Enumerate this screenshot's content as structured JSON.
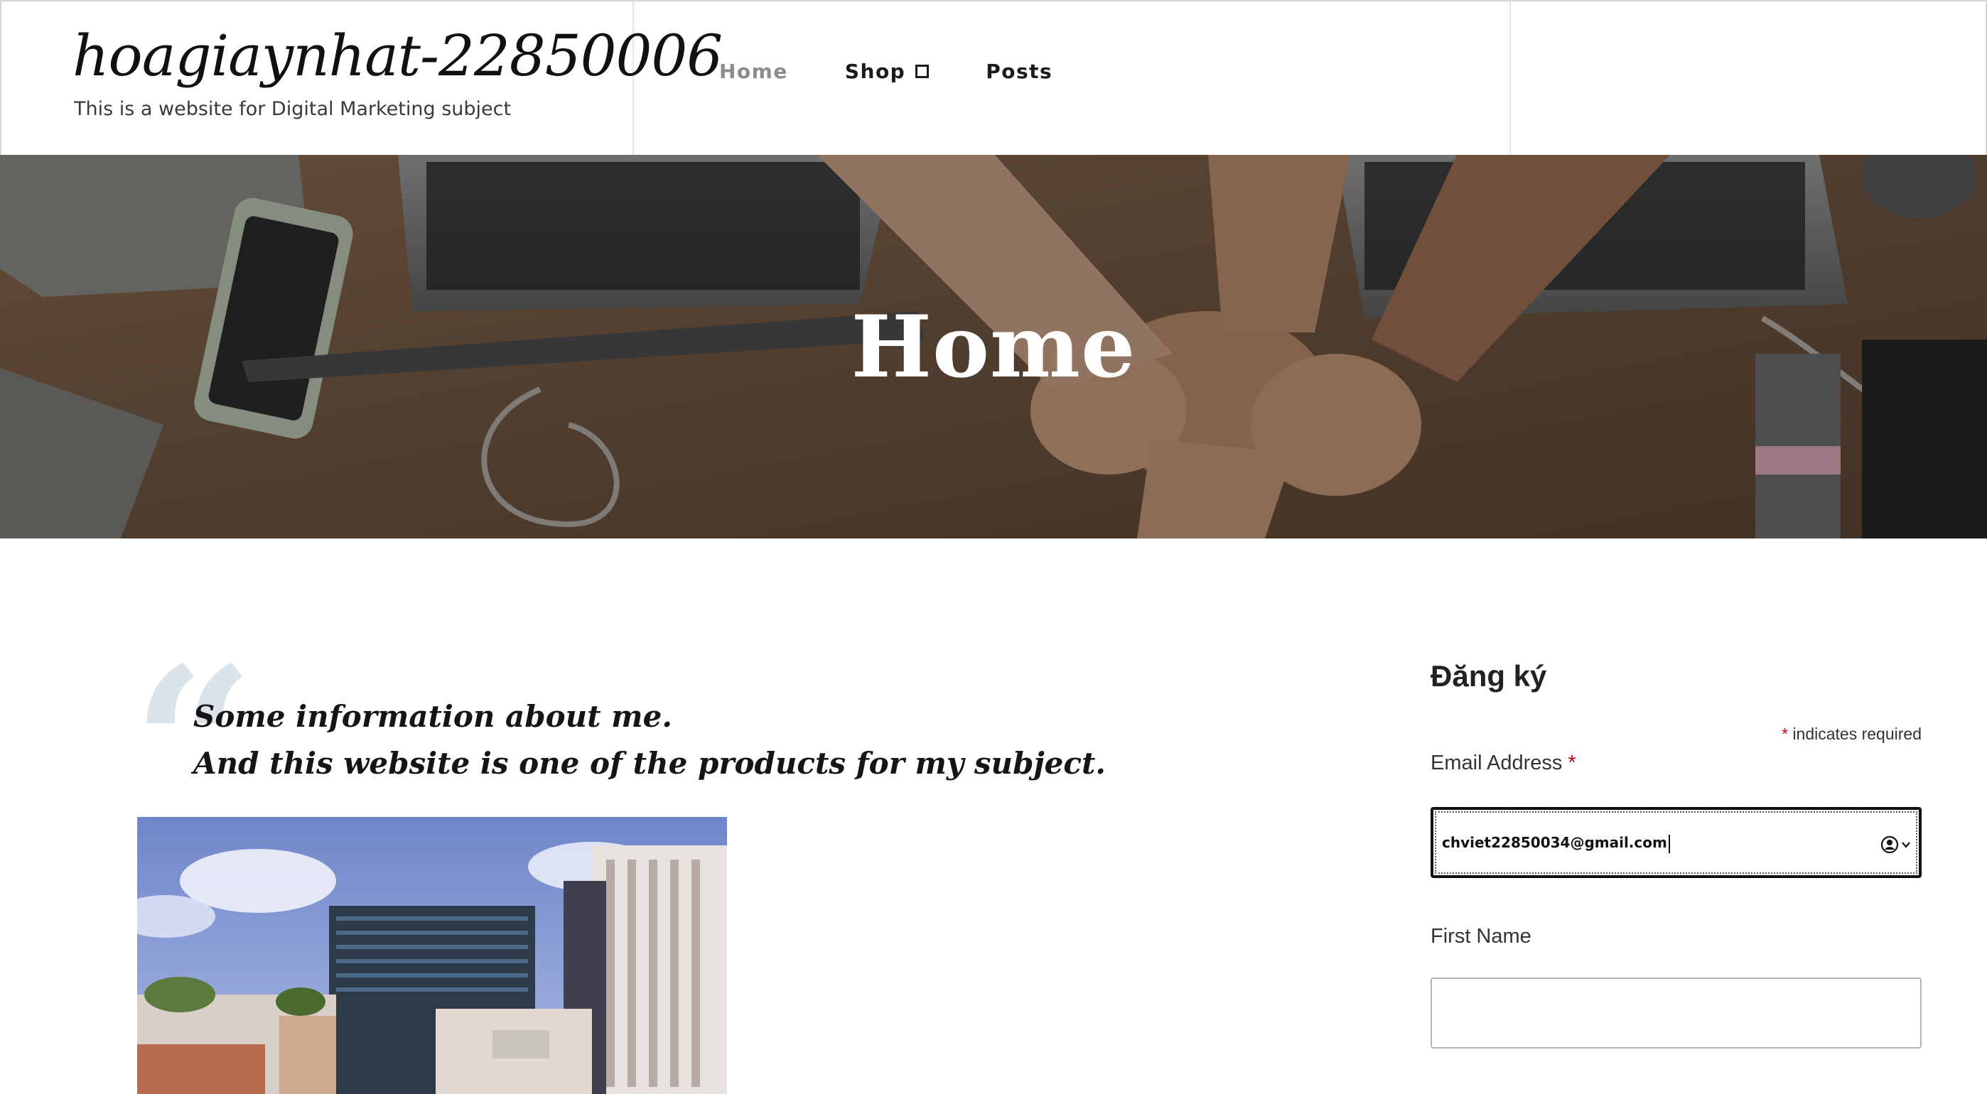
{
  "site": {
    "title": "hoagiaynhat-22850006",
    "tagline": "This is a website for Digital Marketing subject"
  },
  "nav": {
    "items": [
      {
        "label": "Home",
        "active": true
      },
      {
        "label": "Shop",
        "has_dropdown": true
      },
      {
        "label": "Posts"
      }
    ]
  },
  "hero": {
    "title": "Home"
  },
  "content": {
    "quote_line1": "Some information about me.",
    "quote_line2": "And this website is one of the products for my subject."
  },
  "signup": {
    "title": "Đăng ký",
    "required_star": "*",
    "required_note": "indicates required",
    "email_label": "Email Address",
    "email_value": "chviet22850034@gmail.com",
    "first_name_label": "First Name",
    "first_name_value": ""
  },
  "colors": {
    "required": "#d0021b",
    "nav_active": "#8c8c8c",
    "quote_mark": "#dbe4ea"
  },
  "icons": {
    "autofill": "person-circle-icon",
    "autofill_dropdown": "chevron-down-icon"
  }
}
